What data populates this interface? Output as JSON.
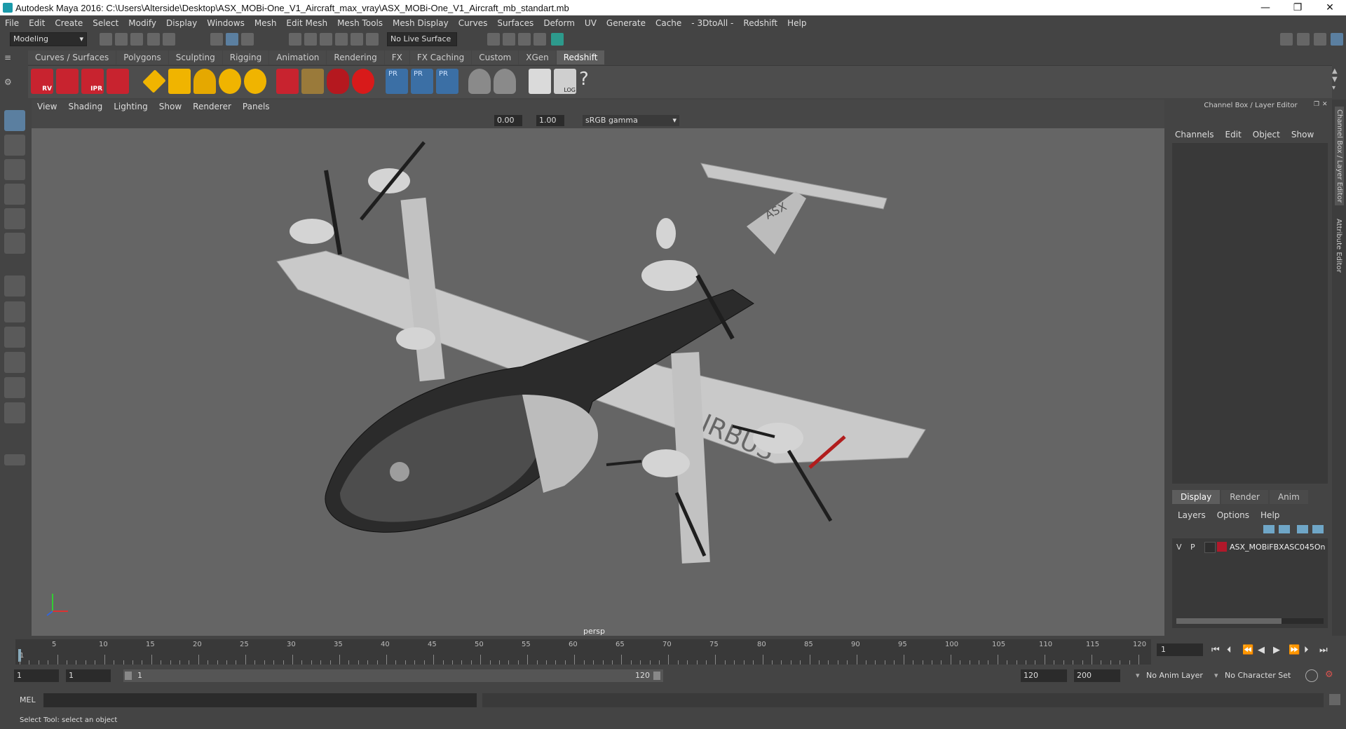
{
  "window": {
    "title": "Autodesk Maya 2016: C:\\Users\\Alterside\\Desktop\\ASX_MOBi-One_V1_Aircraft_max_vray\\ASX_MOBi-One_V1_Aircraft_mb_standart.mb",
    "minimize": "—",
    "maximize": "❐",
    "close": "✕"
  },
  "menubar": [
    "File",
    "Edit",
    "Create",
    "Select",
    "Modify",
    "Display",
    "Windows",
    "Mesh",
    "Edit Mesh",
    "Mesh Tools",
    "Mesh Display",
    "Curves",
    "Surfaces",
    "Deform",
    "UV",
    "Generate",
    "Cache",
    "- 3DtoAll -",
    "Redshift",
    "Help"
  ],
  "statusline": {
    "mode": "Modeling",
    "live_surface": "No Live Surface"
  },
  "shelf_tabs": [
    "Curves / Surfaces",
    "Polygons",
    "Sculpting",
    "Rigging",
    "Animation",
    "Rendering",
    "FX",
    "FX Caching",
    "Custom",
    "XGen",
    "Redshift"
  ],
  "shelf_labels": [
    "RV",
    "IPR",
    "PR",
    "PR",
    "PR",
    "LOG",
    "?"
  ],
  "viewport": {
    "menu": [
      "View",
      "Shading",
      "Lighting",
      "Show",
      "Renderer",
      "Panels"
    ],
    "exposure": "0.00",
    "gamma": "1.00",
    "color_space": "sRGB gamma",
    "camera": "persp",
    "model_text": [
      "ASX",
      "AIRBUS"
    ]
  },
  "channel_box": {
    "title": "Channel Box / Layer Editor",
    "menu": [
      "Channels",
      "Edit",
      "Object",
      "Show"
    ],
    "tabs": [
      "Display",
      "Render",
      "Anim"
    ],
    "layer_menu": [
      "Layers",
      "Options",
      "Help"
    ],
    "layer": {
      "v": "V",
      "p": "P",
      "name": "ASX_MOBiFBXASC045On",
      "color": "#b0182a"
    },
    "side_tabs": [
      "Channel Box / Layer Editor",
      "Attribute Editor"
    ]
  },
  "timeline": {
    "ticks": [
      "5",
      "10",
      "15",
      "20",
      "25",
      "30",
      "35",
      "40",
      "45",
      "50",
      "55",
      "60",
      "65",
      "70",
      "75",
      "80",
      "85",
      "90",
      "95",
      "100",
      "105",
      "110",
      "115",
      "120"
    ],
    "start_marker": "1",
    "current_frame": "1"
  },
  "range": {
    "start": "1",
    "playback_start": "1",
    "slider_start": "1",
    "slider_end": "120",
    "playback_end": "120",
    "end": "200",
    "anim_layer": "No Anim Layer",
    "char_set": "No Character Set"
  },
  "mel": {
    "label": "MEL"
  },
  "help_line": "Select Tool: select an object"
}
